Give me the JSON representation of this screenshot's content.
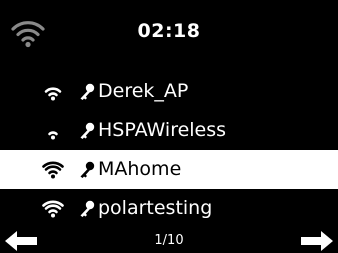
{
  "header": {
    "time": "02:18",
    "wifi_icon": "wifi-signal-icon"
  },
  "networks": [
    {
      "ssid": "Derek_AP",
      "signal_bars": 3,
      "secured": true,
      "selected": false
    },
    {
      "ssid": "HSPAWireless",
      "signal_bars": 2,
      "secured": true,
      "selected": false
    },
    {
      "ssid": "MAhome",
      "signal_bars": 4,
      "secured": true,
      "selected": true
    },
    {
      "ssid": "polartesting",
      "signal_bars": 4,
      "secured": true,
      "selected": false
    }
  ],
  "footer": {
    "page_indicator": "1/10",
    "prev_icon": "arrow-left-icon",
    "next_icon": "arrow-right-icon"
  },
  "colors": {
    "background": "#000000",
    "foreground": "#ffffff",
    "selected_background": "#ffffff",
    "selected_foreground": "#000000",
    "inactive_icon": "#8a8a8a"
  }
}
